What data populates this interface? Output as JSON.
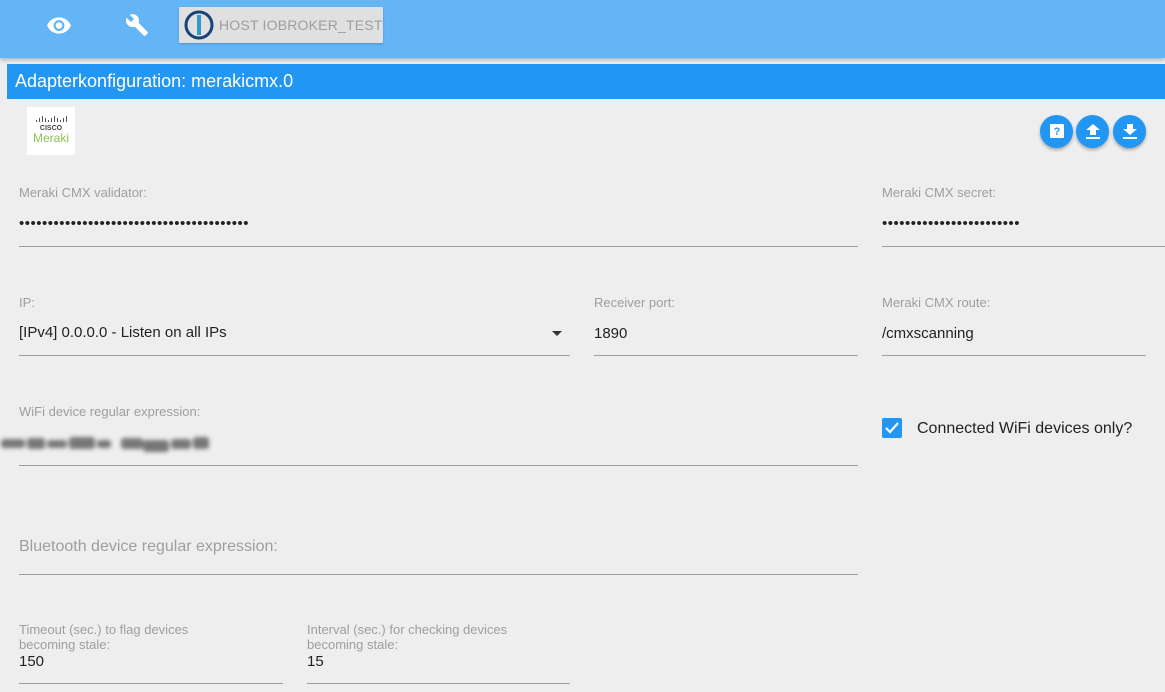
{
  "topbar": {
    "icons": [
      "eye-icon",
      "wrench-icon"
    ],
    "host_label": "HOST IOBROKER_TEST"
  },
  "title": "Adapterkonfiguration: merakicmx.0",
  "logo": {
    "line1": "CISCO",
    "line2": "Meraki"
  },
  "actions": [
    "help-icon",
    "upload-icon",
    "download-icon"
  ],
  "form": {
    "validator": {
      "label": "Meraki CMX validator:",
      "value": "••••••••••••••••••••••••••••••••••••••••"
    },
    "secret": {
      "label": "Meraki CMX secret:",
      "value": "••••••••••••••••••••••••"
    },
    "ip": {
      "label": "IP:",
      "value": "[IPv4] 0.0.0.0 - Listen on all IPs"
    },
    "port": {
      "label": "Receiver port:",
      "value": "1890"
    },
    "route": {
      "label": "Meraki CMX route:",
      "value": "/cmxscanning"
    },
    "wifi_regex": {
      "label": "WiFi device regular expression:"
    },
    "connected_only": {
      "label": "Connected WiFi devices only?",
      "checked": true
    },
    "bt_regex": {
      "placeholder": "Bluetooth device regular expression:"
    },
    "timeout": {
      "label_line1": "Timeout (sec.) to flag devices",
      "label_line2": "becoming stale:",
      "value": "150"
    },
    "interval": {
      "label_line1": "Interval (sec.) for checking devices",
      "label_line2": "becoming stale:",
      "value": "15"
    }
  },
  "colors": {
    "topbar": "#64b5f6",
    "accent": "#2196f3",
    "background": "#eeeeee"
  }
}
